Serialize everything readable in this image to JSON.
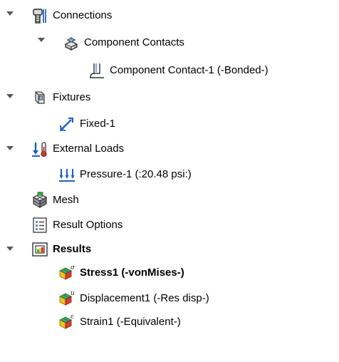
{
  "tree": {
    "connections": {
      "label": "Connections",
      "icon": "connections-icon",
      "expanded": true,
      "component_contacts": {
        "label": "Component Contacts",
        "icon": "component-contacts-icon",
        "expanded": true,
        "contact_1": {
          "label": "Component Contact-1 (-Bonded-)",
          "icon": "component-contact-icon"
        }
      }
    },
    "fixtures": {
      "label": "Fixtures",
      "icon": "fixtures-icon",
      "expanded": true,
      "fixed_1": {
        "label": "Fixed-1",
        "icon": "fixed-geometry-icon"
      }
    },
    "external_loads": {
      "label": "External Loads",
      "icon": "external-loads-icon",
      "expanded": true,
      "pressure_1": {
        "label": "Pressure-1 (:20.48 psi:)",
        "icon": "pressure-icon"
      }
    },
    "mesh": {
      "label": "Mesh",
      "icon": "mesh-icon"
    },
    "result_options": {
      "label": "Result Options",
      "icon": "result-options-icon"
    },
    "results": {
      "label": "Results",
      "icon": "results-folder-icon",
      "expanded": true,
      "stress1": {
        "label": "Stress1 (-vonMises-)",
        "icon": "stress-plot-icon",
        "active": true
      },
      "displacement1": {
        "label": "Displacement1 (-Res disp-)",
        "icon": "displacement-plot-icon"
      },
      "strain1": {
        "label": "Strain1 (-Equivalent-)",
        "icon": "strain-plot-icon"
      }
    }
  },
  "colors": {
    "expander_arrow": "#5a5a5a",
    "load_arrow": "#1f5fbf",
    "plot_green": "#3cb043",
    "plot_red": "#e0382b",
    "plot_yellow": "#f2c319"
  }
}
